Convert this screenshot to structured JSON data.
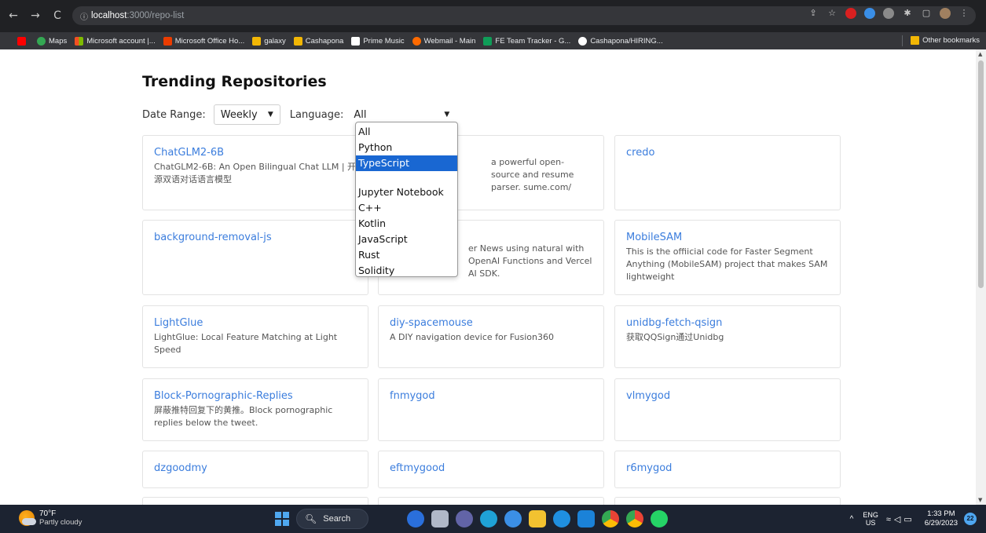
{
  "browser": {
    "url_host": "localhost",
    "url_rest": ":3000/repo-list",
    "bookmarks": [
      {
        "label": "",
        "color": "#ff0000"
      },
      {
        "label": "Maps",
        "color": "#34a853"
      },
      {
        "label": "Microsoft account |...",
        "color": "#f25022"
      },
      {
        "label": "Microsoft Office Ho...",
        "color": "#eb3c00"
      },
      {
        "label": "galaxy",
        "color": "#f2b705"
      },
      {
        "label": "Cashapona",
        "color": "#f2b705"
      },
      {
        "label": "Prime Music",
        "color": "#ffffff"
      },
      {
        "label": "Webmail - Main",
        "color": "#ff6a00"
      },
      {
        "label": "FE Team Tracker - G...",
        "color": "#0f9d58"
      },
      {
        "label": "Cashapona/HIRING...",
        "color": "#ffffff"
      }
    ],
    "other_bookmarks": "Other bookmarks"
  },
  "page": {
    "title": "Trending Repositories",
    "date_range_label": "Date Range:",
    "date_range_value": "Weekly",
    "language_label": "Language:",
    "language_value": "All"
  },
  "language_options": [
    "All",
    "Python",
    "TypeScript",
    "",
    "Jupyter Notebook",
    "C++",
    "Kotlin",
    "JavaScript",
    "Rust",
    "Solidity"
  ],
  "language_selected_index": 2,
  "repos": [
    {
      "name": "ChatGLM2-6B",
      "desc": "ChatGLM2-6B: An Open Bilingual Chat LLM | 开源双语对话语言模型"
    },
    {
      "name": "",
      "desc": "a powerful open-source and resume parser. sume.com/"
    },
    {
      "name": "credo",
      "desc": ""
    },
    {
      "name": "background-removal-js",
      "desc": ""
    },
    {
      "name": "",
      "desc": "er News using natural with OpenAI Functions and Vercel AI SDK."
    },
    {
      "name": "MobileSAM",
      "desc": "This is the offiicial code for Faster Segment Anything (MobileSAM) project that makes SAM lightweight"
    },
    {
      "name": "LightGlue",
      "desc": "LightGlue: Local Feature Matching at Light Speed"
    },
    {
      "name": "diy-spacemouse",
      "desc": "A DIY navigation device for Fusion360"
    },
    {
      "name": "unidbg-fetch-qsign",
      "desc": "获取QQSign通过Unidbg"
    },
    {
      "name": "Block-Pornographic-Replies",
      "desc": "屏蔽推特回复下的黄推。Block pornographic replies below the tweet."
    },
    {
      "name": "fnmygod",
      "desc": ""
    },
    {
      "name": "vlmygod",
      "desc": ""
    },
    {
      "name": "dzgoodmy",
      "desc": ""
    },
    {
      "name": "eftmygood",
      "desc": ""
    },
    {
      "name": "r6mygod",
      "desc": ""
    }
  ],
  "taskbar": {
    "temp": "70°F",
    "condition": "Partly cloudy",
    "search": "Search",
    "lang_top": "ENG",
    "lang_bottom": "US",
    "time": "1:33 PM",
    "date": "6/29/2023",
    "notifications": "22"
  }
}
